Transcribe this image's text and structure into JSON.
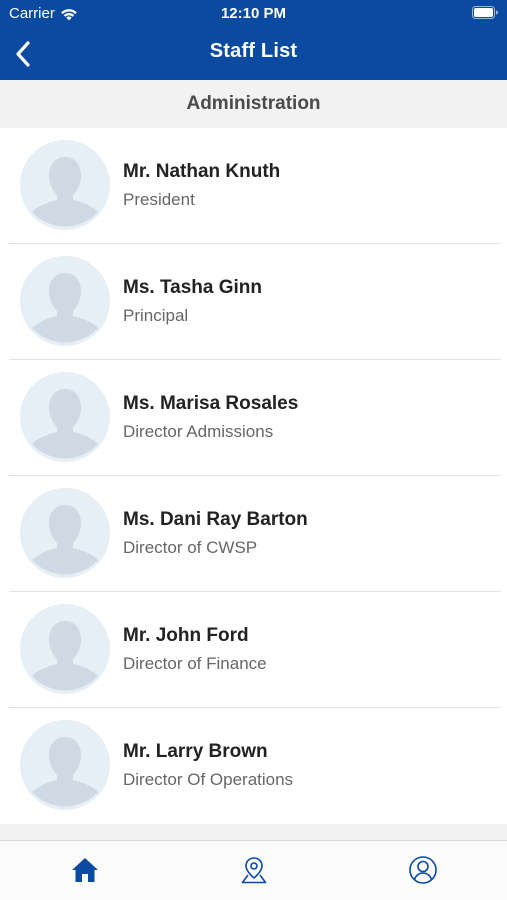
{
  "status_bar": {
    "carrier": "Carrier",
    "time": "12:10 PM"
  },
  "nav": {
    "title": "Staff List",
    "back_icon": "chevron-left-icon"
  },
  "section": {
    "title": "Administration"
  },
  "staff": [
    {
      "name": "Mr. Nathan Knuth",
      "title": "President"
    },
    {
      "name": "Ms. Tasha Ginn",
      "title": "Principal"
    },
    {
      "name": "Ms. Marisa Rosales",
      "title": "Director Admissions"
    },
    {
      "name": "Ms. Dani Ray Barton",
      "title": "Director of CWSP"
    },
    {
      "name": "Mr. John Ford",
      "title": "Director of Finance"
    },
    {
      "name": "Mr. Larry Brown",
      "title": "Director Of Operations"
    }
  ],
  "tab_bar": {
    "tabs": [
      {
        "icon": "home-icon",
        "active": true
      },
      {
        "icon": "map-pin-icon",
        "active": false
      },
      {
        "icon": "profile-icon",
        "active": false
      }
    ]
  },
  "colors": {
    "brand": "#0a4aa0",
    "section_bg": "#f2f2f2",
    "avatar_bg": "#e6eef6",
    "avatar_figure": "#cfd9e4"
  }
}
